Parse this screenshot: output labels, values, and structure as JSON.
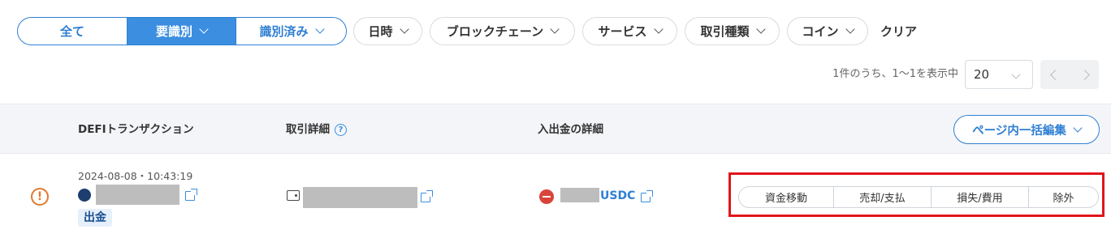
{
  "filters": {
    "segment": {
      "all_label": "全て",
      "needs_id_label": "要識別",
      "identified_label": "識別済み"
    },
    "dropdowns": [
      "日時",
      "ブロックチェーン",
      "サービス",
      "取引種類",
      "コイン"
    ],
    "clear_label": "クリア"
  },
  "pagination": {
    "info": "1件のうち、1〜1を表示中",
    "per_page": "20"
  },
  "table": {
    "headers": {
      "defi": "DEFIトランザクション",
      "detail": "取引詳細",
      "inout": "入出金の詳細"
    },
    "bulk_edit_label": "ページ内一括編集",
    "rows": [
      {
        "timestamp": "2024-08-08・10:43:19",
        "direction_badge": "出金",
        "coin": "USDC",
        "actions": [
          "資金移動",
          "売却/支払",
          "損失/費用",
          "除外"
        ]
      }
    ]
  },
  "colors": {
    "accent": "#3b8ee0",
    "warning": "#e07a2e",
    "outflow": "#d9443a",
    "highlight": "#e2141b"
  }
}
